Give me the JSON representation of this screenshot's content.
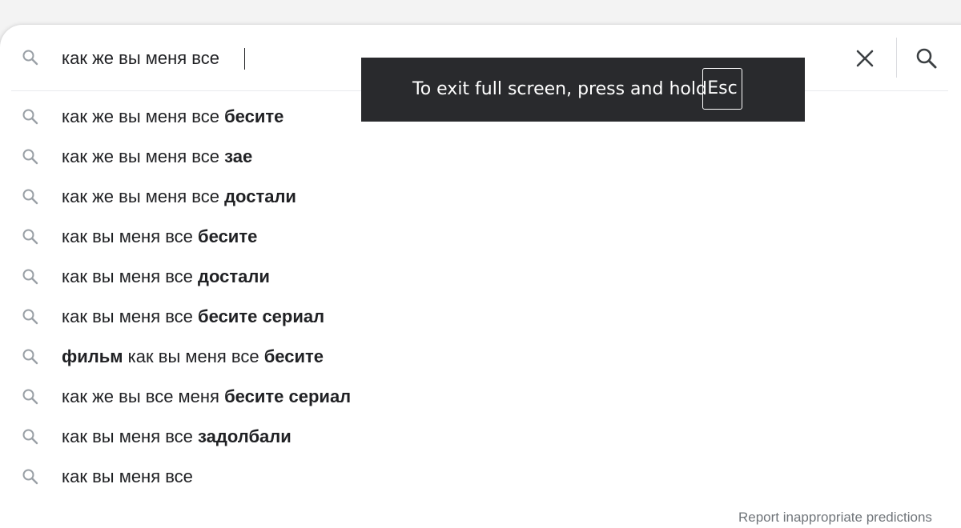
{
  "search": {
    "query": "как же вы меня все",
    "clear_label": "Clear",
    "submit_label": "Search"
  },
  "suggestions": [
    {
      "prefix": "",
      "normal": "как же вы меня все ",
      "bold": "бесите",
      "after": "",
      "tail_bold": ""
    },
    {
      "prefix": "",
      "normal": "как же вы меня все ",
      "bold": "зае",
      "after": "",
      "tail_bold": ""
    },
    {
      "prefix": "",
      "normal": "как же вы меня все ",
      "bold": "достали",
      "after": "",
      "tail_bold": ""
    },
    {
      "prefix": "",
      "normal": "как вы меня все ",
      "bold": "бесите",
      "after": "",
      "tail_bold": ""
    },
    {
      "prefix": "",
      "normal": "как вы меня все ",
      "bold": "достали",
      "after": "",
      "tail_bold": ""
    },
    {
      "prefix": "",
      "normal": "как вы меня все ",
      "bold": "бесите сериал",
      "after": "",
      "tail_bold": ""
    },
    {
      "prefix": "фильм",
      "normal": " как вы меня все ",
      "bold": "бесите",
      "after": "",
      "tail_bold": ""
    },
    {
      "prefix": "",
      "normal": "как же вы все меня ",
      "bold": "бесите сериал",
      "after": "",
      "tail_bold": ""
    },
    {
      "prefix": "",
      "normal": "как вы меня все ",
      "bold": "задолбали",
      "after": "",
      "tail_bold": ""
    },
    {
      "prefix": "",
      "normal": "как вы меня все",
      "bold": "",
      "after": "",
      "tail_bold": ""
    }
  ],
  "report_link": "Report inappropriate predictions",
  "fullscreen_toast": {
    "message": "To exit full screen, press and hold",
    "key": "Esc"
  },
  "left_edge_char": "A",
  "colors": {
    "text": "#202124",
    "icon": "#9aa0a6",
    "secondary": "#70757a",
    "toast_bg": "#292a2d"
  }
}
